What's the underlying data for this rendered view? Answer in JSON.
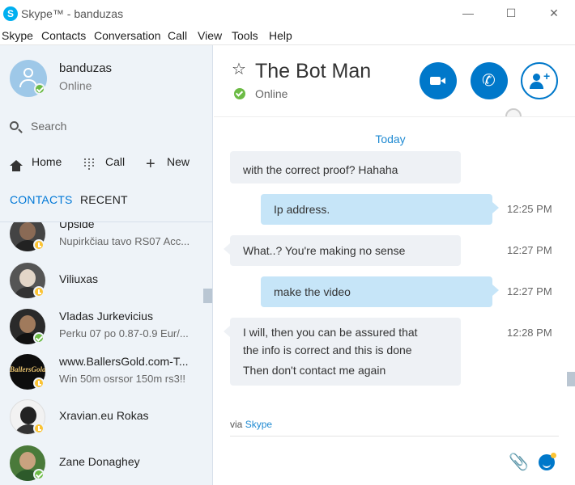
{
  "window": {
    "title": "Skype™ - banduzas",
    "minimize": "—",
    "maximize": "☐",
    "close": "✕"
  },
  "menu": [
    "Skype",
    "Contacts",
    "Conversation",
    "Call",
    "View",
    "Tools",
    "Help"
  ],
  "profile": {
    "name": "banduzas",
    "status": "Online"
  },
  "search": {
    "placeholder": "Search"
  },
  "nav": {
    "home": "Home",
    "call": "Call",
    "new": "New"
  },
  "tabs": {
    "contacts": "CONTACTS",
    "recent": "RECENT"
  },
  "contacts": [
    {
      "name": "Upside",
      "sub": "Nupirkčiau tavo RS07 Acc...",
      "status": "away"
    },
    {
      "name": "Viliuxas",
      "sub": "",
      "status": "away"
    },
    {
      "name": "Vladas Jurkevicius",
      "sub": "Perku 07 po 0.87-0.9 Eur/...",
      "status": "online"
    },
    {
      "name": "www.BallersGold.com-T...",
      "sub": "Win 50m osrsor 150m rs3!!",
      "status": "away",
      "avatar_text": "BallersGold"
    },
    {
      "name": "Xravian.eu Rokas",
      "sub": "",
      "status": "away"
    },
    {
      "name": "Zane Donaghey",
      "sub": "",
      "status": "online"
    }
  ],
  "conversation": {
    "title": "The Bot Man",
    "status": "Online",
    "date_separator": "Today",
    "messages": [
      {
        "dir": "in",
        "lines": [
          "with the correct proof? Hahaha"
        ],
        "time": ""
      },
      {
        "dir": "out",
        "lines": [
          "Ip address."
        ],
        "time": "12:25 PM"
      },
      {
        "dir": "in",
        "lines": [
          "What..? You're making no sense"
        ],
        "time": "12:27 PM"
      },
      {
        "dir": "out",
        "lines": [
          "make the video"
        ],
        "time": "12:27 PM"
      },
      {
        "dir": "in",
        "lines": [
          "I will, then you can be assured that",
          "the info is correct and this is done",
          "Then don't contact me again"
        ],
        "time": "12:28 PM"
      }
    ],
    "via_prefix": "via",
    "via_link": "Skype"
  },
  "colors": {
    "accent": "#0078ca",
    "online": "#6cbb45",
    "away": "#fbc333",
    "sidebar_bg": "#eef3f8"
  }
}
